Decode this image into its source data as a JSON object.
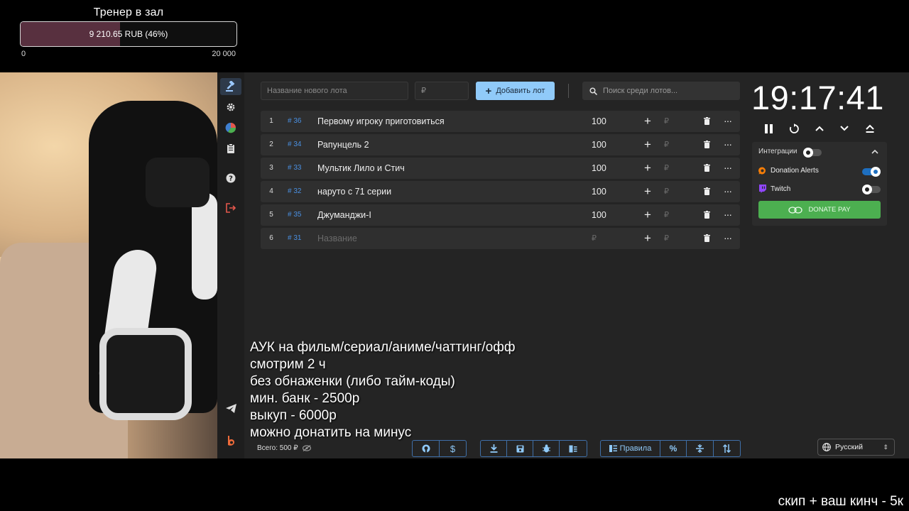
{
  "goal": {
    "title": "Тренер в зал",
    "amount_text": "9 210.65 RUB (46%)",
    "progress_fraction": 0.46,
    "min": "0",
    "max": "20 000"
  },
  "sidebar": {
    "items": [
      {
        "icon": "gavel-icon",
        "active": true
      },
      {
        "icon": "gear-icon"
      },
      {
        "icon": "pie-chart-icon"
      },
      {
        "icon": "clipboard-icon"
      },
      {
        "icon": "help-icon"
      },
      {
        "icon": "logout-icon"
      },
      {
        "icon": "telegram-icon"
      },
      {
        "icon": "brand-b-icon"
      }
    ]
  },
  "toolbar": {
    "new_lot_placeholder": "Название нового лота",
    "amount_placeholder": "₽",
    "add_lot_label": "Добавить лот",
    "search_placeholder": "Поиск среди лотов..."
  },
  "lots": [
    {
      "n": "1",
      "id": "# 36",
      "name": "Первому игроку приготовиться",
      "amount": "100"
    },
    {
      "n": "2",
      "id": "# 34",
      "name": "Рапунцель 2",
      "amount": "100"
    },
    {
      "n": "3",
      "id": "# 33",
      "name": "Мультик Лило и Стич",
      "amount": "100"
    },
    {
      "n": "4",
      "id": "# 32",
      "name": "наруто с 71 серии",
      "amount": "100"
    },
    {
      "n": "5",
      "id": "# 35",
      "name": "Джуманджи-I",
      "amount": "100"
    },
    {
      "n": "6",
      "id": "# 31",
      "name": "Название",
      "amount": "₽",
      "placeholder": true
    }
  ],
  "lot_row": {
    "plus": "+",
    "currency": "₽",
    "more": "···"
  },
  "overlay_lines": [
    "АУК на фильм/сериал/аниме/чаттинг/офф",
    "смотрим 2 ч",
    "без обнаженки (либо тайм-коды)",
    "мин. банк - 2500р",
    "выкуп - 6000р",
    "можно донатить на минус"
  ],
  "footer": {
    "total_text": "Всего: 500 ₽",
    "rules_label": "Правила"
  },
  "timer": {
    "value": "19:17:41"
  },
  "integrations": {
    "header": "Интеграции",
    "items": [
      {
        "name": "Donation Alerts",
        "enabled": true
      },
      {
        "name": "Twitch",
        "enabled": false
      }
    ],
    "donate_pay_label": "DONATE PAY"
  },
  "language": {
    "selected": "Русский"
  },
  "bottom_caption": "скип + ваш кинч - 5к",
  "colors": {
    "accent": "#90caf9",
    "id_blue": "#4a90e2",
    "donate_green": "#4caf50",
    "goal_fill": "#58303f",
    "logout_red": "#e4574c"
  }
}
